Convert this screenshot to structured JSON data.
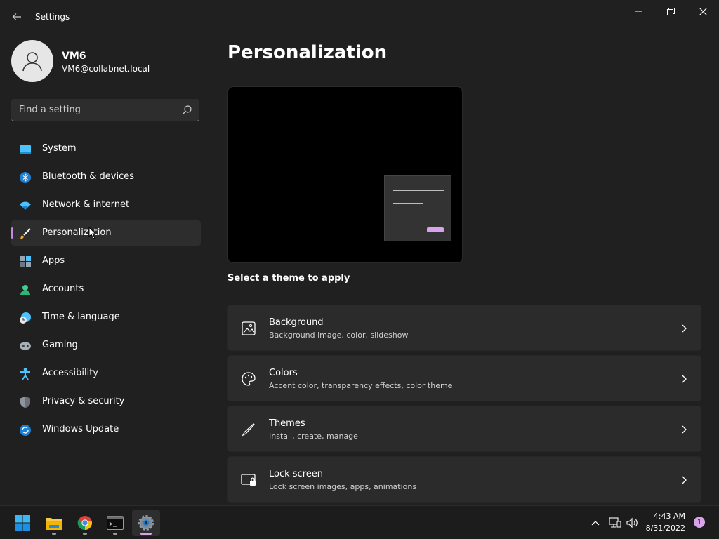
{
  "window": {
    "title": "Settings",
    "back_icon": "back-arrow-icon",
    "controls": [
      "minimize-icon",
      "restore-icon",
      "close-icon"
    ]
  },
  "profile": {
    "name": "VM6",
    "email": "VM6@collabnet.local",
    "avatar_icon": "person-icon"
  },
  "search": {
    "placeholder": "Find a setting",
    "value": "",
    "icon": "search-icon"
  },
  "nav": {
    "selected": "Personalization",
    "items": [
      {
        "label": "System",
        "icon": "monitor-icon"
      },
      {
        "label": "Bluetooth & devices",
        "icon": "bluetooth-icon"
      },
      {
        "label": "Network & internet",
        "icon": "wifi-icon"
      },
      {
        "label": "Personalization",
        "icon": "brush-icon"
      },
      {
        "label": "Apps",
        "icon": "apps-icon"
      },
      {
        "label": "Accounts",
        "icon": "account-icon"
      },
      {
        "label": "Time & language",
        "icon": "clock-globe-icon"
      },
      {
        "label": "Gaming",
        "icon": "gamepad-icon"
      },
      {
        "label": "Accessibility",
        "icon": "accessibility-icon"
      },
      {
        "label": "Privacy & security",
        "icon": "shield-icon"
      },
      {
        "label": "Windows Update",
        "icon": "update-icon"
      }
    ]
  },
  "main": {
    "title": "Personalization",
    "section_label": "Select a theme to apply",
    "cards": [
      {
        "title": "Background",
        "subtitle": "Background image, color, slideshow",
        "icon": "image-icon"
      },
      {
        "title": "Colors",
        "subtitle": "Accent color, transparency effects, color theme",
        "icon": "palette-icon"
      },
      {
        "title": "Themes",
        "subtitle": "Install, create, manage",
        "icon": "pen-icon"
      },
      {
        "title": "Lock screen",
        "subtitle": "Lock screen images, apps, animations",
        "icon": "lock-screen-icon"
      }
    ]
  },
  "taskbar": {
    "apps": [
      "start-icon",
      "file-explorer-icon",
      "chrome-icon",
      "terminal-icon",
      "settings-icon"
    ],
    "active_app": "settings-icon",
    "tray_icons": [
      "chevron-up-icon",
      "network-icon",
      "volume-icon"
    ],
    "time": "4:43 AM",
    "date": "8/31/2022",
    "notification_count": "1"
  },
  "colors": {
    "background": "#202020",
    "surface": "#2b2b2b",
    "accent": "#d9a3ea"
  }
}
